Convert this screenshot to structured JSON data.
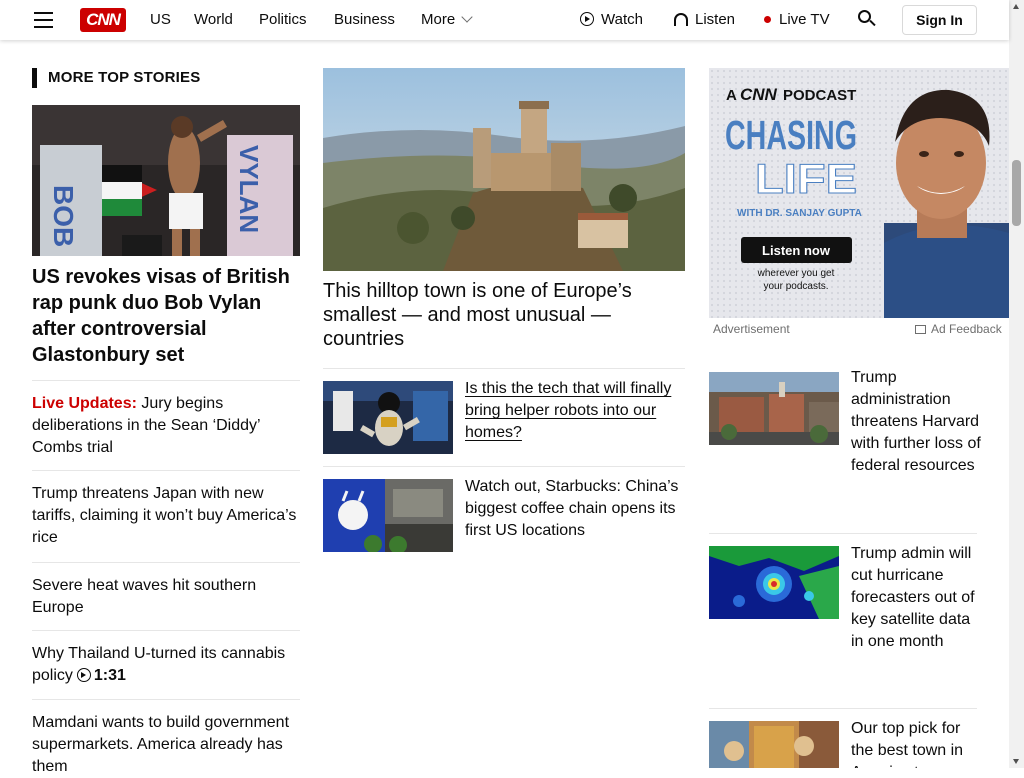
{
  "header": {
    "logo": "CNN",
    "nav": [
      "US",
      "World",
      "Politics",
      "Business",
      "More"
    ],
    "watch": "Watch",
    "listen": "Listen",
    "live_tv": "Live TV",
    "sign_in": "Sign In"
  },
  "section_title": "MORE TOP STORIES",
  "left": {
    "lead_headline": "US revokes visas of British rap punk duo Bob Vylan after controversial Glastonbury set",
    "lead_image_text": {
      "left_word": "BOB",
      "right_word": "VYLAN"
    },
    "stories": [
      {
        "prefix": "Live Updates:",
        "text": "Jury begins deliberations in the Sean ‘Diddy’ Combs trial"
      },
      {
        "text": "Trump threatens Japan with new tariffs, claiming it won’t buy America’s rice"
      },
      {
        "text": "Severe heat waves hit southern Europe"
      },
      {
        "text": "Why Thailand U-turned its cannabis policy",
        "duration": "1:31"
      },
      {
        "text": "Mamdani wants to build government supermarkets. America already has them"
      }
    ]
  },
  "middle": {
    "lead_headline": "This hilltop town is one of Europe’s smallest — and most unusual — countries",
    "stories": [
      {
        "text": "Is this the tech that will finally bring helper robots into our homes?"
      },
      {
        "text": "Watch out, Starbucks: China’s biggest coffee chain opens its first US locations"
      }
    ]
  },
  "ad": {
    "kicker_a": "A",
    "kicker_cnn": "CNN",
    "kicker_podcast": "PODCAST",
    "title_1": "CHASING",
    "title_2": "LIFE",
    "with": "WITH DR. SANJAY GUPTA",
    "cta": "Listen now",
    "sub": "wherever you get your podcasts.",
    "label": "Advertisement",
    "feedback": "Ad Feedback"
  },
  "right": {
    "stories": [
      {
        "text": "Trump administration threatens Harvard with further loss of federal resources"
      },
      {
        "text": "Trump admin will cut hurricane forecasters out of key satellite data in one month"
      },
      {
        "text": "Our top pick for the best town in America to"
      }
    ]
  },
  "colors": {
    "brand": "#cc0000",
    "text": "#0c0c0c",
    "ad_blue": "#4a7fc1"
  }
}
